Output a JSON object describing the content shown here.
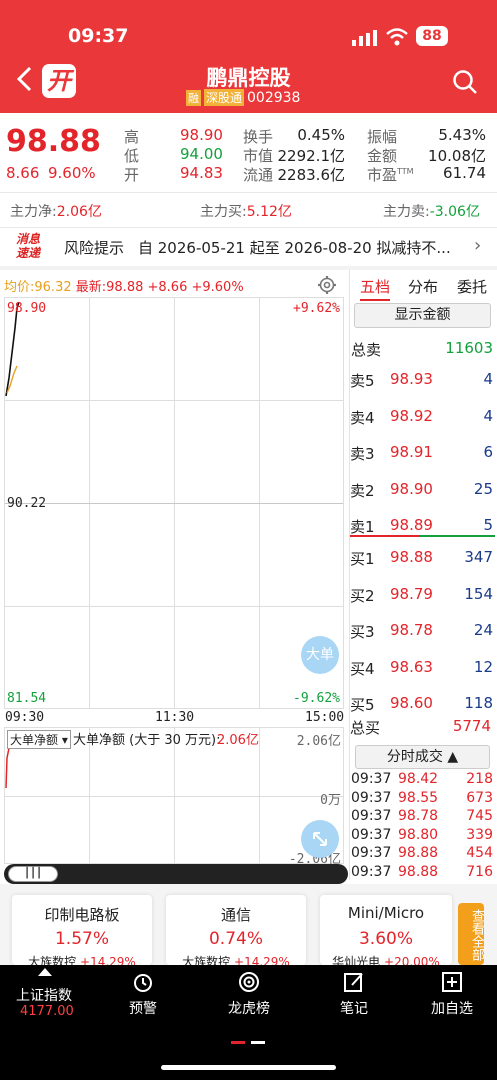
{
  "status": {
    "time": "09:37",
    "battery": "88"
  },
  "header": {
    "back_icon": "back-arrow-icon",
    "logo": "开",
    "title": "鹏鼎控股",
    "badge_rong": "融",
    "badge_sgt": "深股通",
    "code": "002938",
    "search_icon": "search-icon"
  },
  "quote": {
    "price": "98.88",
    "change": "8.66",
    "pct": "9.60%",
    "high_label": "高",
    "high": "98.90",
    "low_label": "低",
    "low": "94.00",
    "open_label": "开",
    "open": "94.83",
    "turnover_label": "换手",
    "turnover": "0.45%",
    "mcap_label": "市值",
    "mcap": "2292.1亿",
    "float_label": "流通",
    "float": "2283.6亿",
    "amp_label": "振幅",
    "amp": "5.43%",
    "amount_label": "金额",
    "amount": "10.08亿",
    "pe_label": "市盈",
    "pe_tm": "TTM",
    "pe": "61.74"
  },
  "flow": {
    "net_label": "主力净:",
    "net": "2.06亿",
    "buy_label": "主力买:",
    "buy": "5.12亿",
    "sell_label": "主力卖:",
    "sell": "-3.06亿"
  },
  "news": {
    "logo_top": "消息",
    "logo_bottom": "速递",
    "label": "风险提示",
    "text": "自 2026-05-21 起至 2026-08-20 拟减持不..."
  },
  "chart_info": {
    "avg_label": "均价:",
    "avg": "96.32",
    "latest_label": "最新:",
    "latest": "98.88",
    "chg": "+8.66",
    "pct": "+9.60%",
    "gear_icon": "gear-icon"
  },
  "chart_data": [
    {
      "type": "line",
      "y_ticks_left": [
        "98.90",
        "90.22",
        "81.54"
      ],
      "y_ticks_right": [
        "+9.62%",
        "-9.62%"
      ],
      "x_ticks": [
        "09:30",
        "11:30",
        "15:00"
      ],
      "ylim": [
        81.54,
        98.9
      ],
      "series": [],
      "big_order_button": "大单"
    },
    {
      "type": "line",
      "selector": "大单净额",
      "title": "大单净额 (大于 30 万元):",
      "value": "2.06亿",
      "y_ticks": [
        "2.06亿",
        "0万",
        "-2.06亿"
      ],
      "series": [],
      "expand_icon": "expand-icon"
    }
  ],
  "orderbook": {
    "tabs": [
      "五档",
      "分布",
      "委托"
    ],
    "show_amount": "显示金额",
    "total_sell_label": "总卖",
    "total_sell": "11603",
    "asks": [
      {
        "label": "卖5",
        "price": "98.93",
        "vol": "4"
      },
      {
        "label": "卖4",
        "price": "98.92",
        "vol": "4"
      },
      {
        "label": "卖3",
        "price": "98.91",
        "vol": "6"
      },
      {
        "label": "卖2",
        "price": "98.90",
        "vol": "25"
      },
      {
        "label": "卖1",
        "price": "98.89",
        "vol": "5"
      }
    ],
    "bids": [
      {
        "label": "买1",
        "price": "98.88",
        "vol": "347"
      },
      {
        "label": "买2",
        "price": "98.79",
        "vol": "154"
      },
      {
        "label": "买3",
        "price": "98.78",
        "vol": "24"
      },
      {
        "label": "买4",
        "price": "98.63",
        "vol": "12"
      },
      {
        "label": "买5",
        "price": "98.60",
        "vol": "118"
      }
    ],
    "total_buy_label": "总买",
    "total_buy": "5774",
    "trades_label": "分时成交",
    "trades": [
      {
        "t": "09:37",
        "p": "98.42",
        "v": "218"
      },
      {
        "t": "09:37",
        "p": "98.55",
        "v": "673"
      },
      {
        "t": "09:37",
        "p": "98.78",
        "v": "745"
      },
      {
        "t": "09:37",
        "p": "98.80",
        "v": "339"
      },
      {
        "t": "09:37",
        "p": "98.88",
        "v": "454"
      },
      {
        "t": "09:37",
        "p": "98.88",
        "v": "716"
      }
    ]
  },
  "sectors": [
    {
      "name": "印制电路板",
      "pct": "1.57%",
      "sub": "大族数控",
      "sub_pct": "+14.29%"
    },
    {
      "name": "通信",
      "pct": "0.74%",
      "sub": "大族数控",
      "sub_pct": "+14.29%"
    },
    {
      "name": "Mini/Micro",
      "pct": "3.60%",
      "sub": "华灿光电",
      "sub_pct": "+20.00%"
    }
  ],
  "view_all": "查看全部",
  "bottom_nav": {
    "index_name": "上证指数",
    "index_value": "4177.00",
    "items": [
      "预警",
      "龙虎榜",
      "笔记",
      "加自选"
    ]
  }
}
